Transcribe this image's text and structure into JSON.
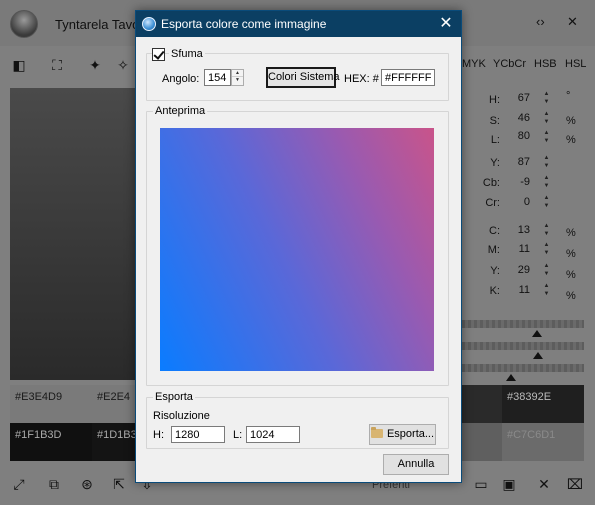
{
  "background": {
    "app_title": "Tyntarela Tavo",
    "color_tabs": [
      "MYK",
      "YCbCr",
      "HSB",
      "HSL"
    ],
    "hsl_rows": [
      {
        "label": "H:",
        "value": "67",
        "unit": "°"
      },
      {
        "label": "S:",
        "value": "46",
        "unit": "%"
      },
      {
        "label": "L:",
        "value": "80",
        "unit": "%"
      }
    ],
    "ycbcr_rows": [
      {
        "label": "Y:",
        "value": "87"
      },
      {
        "label": "Cb:",
        "value": "-9"
      },
      {
        "label": "Cr:",
        "value": "0"
      }
    ],
    "cmyk_rows": [
      {
        "label": "C:",
        "value": "13",
        "unit": "%"
      },
      {
        "label": "M:",
        "value": "11",
        "unit": "%"
      },
      {
        "label": "Y:",
        "value": "29",
        "unit": "%"
      },
      {
        "label": "K:",
        "value": "11",
        "unit": "%"
      }
    ],
    "swatches": [
      {
        "hex": "#E3E4D9",
        "color": "#7a7a7a"
      },
      {
        "hex": "#E2E4",
        "color": "#7a7a7a"
      },
      {
        "hex": "#38392E",
        "color": "#1f1f1f"
      },
      {
        "hex": "#1F1B3D",
        "color": "#101010"
      },
      {
        "hex": "#1D1B3",
        "color": "#141414"
      },
      {
        "hex": "#C7C6D1",
        "color": "#6b6b6b"
      }
    ],
    "favorites_label": "Preferiti"
  },
  "dialog": {
    "title": "Esporta colore come immagine",
    "gradient_group": {
      "checkbox_label": "Sfuma",
      "checked": true,
      "angle_label": "Angolo:",
      "angle_value": "154",
      "system_colors_button": "Colori Sistema",
      "hex_label": "HEX: #",
      "hex_value": "#FFFFFF"
    },
    "preview_group": {
      "title": "Anteprima",
      "gradient_colors": [
        "#0a7cff",
        "#5a68d8",
        "#9a5ab0",
        "#c9548a"
      ]
    },
    "export_group": {
      "title": "Esporta",
      "resolution_label": "Risoluzione",
      "width_label": "H:",
      "width_value": "1280",
      "height_label": "L:",
      "height_value": "1024",
      "export_button": "Esporta..."
    },
    "cancel_button": "Annulla"
  }
}
